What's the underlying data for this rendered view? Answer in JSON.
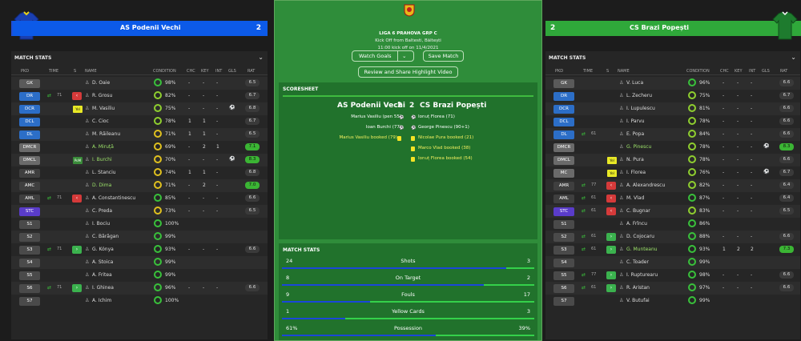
{
  "left": {
    "team": "AS Podenii Vechi",
    "score": "2",
    "section_title": "MATCH STATS",
    "headers": {
      "pkd": "PKD",
      "time": "TIME",
      "s": "S",
      "name": "NAME",
      "cond": "CONDITION",
      "chc": "CHC",
      "key": "KEY",
      "int": "INT",
      "gls": "GLS",
      "rat": "RAT"
    },
    "players": [
      {
        "pos": "GK",
        "name": "D. Oaie",
        "cond": "98%",
        "chc": "-",
        "key": "-",
        "int": "-",
        "rat": "6.5"
      },
      {
        "pos": "DR",
        "name": "R. Grosu",
        "cond": "82%",
        "chc": "-",
        "key": "-",
        "int": "-",
        "rat": "6.7",
        "time": "71",
        "btn": "red"
      },
      {
        "pos": "DCR",
        "name": "M. Vasiliu",
        "cond": "75%",
        "chc": "-",
        "key": "-",
        "int": "-",
        "rat": "6.8",
        "tag": "Yel",
        "ball": true
      },
      {
        "pos": "DCL",
        "name": "C. Cioc",
        "cond": "78%",
        "chc": "1",
        "key": "1",
        "int": "-",
        "rat": "6.7"
      },
      {
        "pos": "DL",
        "name": "M. Răileanu",
        "cond": "71%",
        "chc": "1",
        "key": "1",
        "int": "-",
        "rat": "6.5"
      },
      {
        "pos": "DMCR",
        "name": "A. Miruță",
        "cond": "69%",
        "chc": "-",
        "key": "2",
        "int": "1",
        "rat": "7.1",
        "good": true
      },
      {
        "pos": "DMCL",
        "name": "I. Burchi",
        "cond": "70%",
        "chc": "-",
        "key": "-",
        "int": "-",
        "rat": "8.3",
        "good": true,
        "tag": "PoM",
        "ball": true
      },
      {
        "pos": "AMR",
        "name": "L. Stanciu",
        "cond": "74%",
        "chc": "1",
        "key": "1",
        "int": "-",
        "rat": "6.8"
      },
      {
        "pos": "AMC",
        "name": "D. Dima",
        "cond": "71%",
        "chc": "-",
        "key": "2",
        "int": "-",
        "rat": "7.0",
        "good": true
      },
      {
        "pos": "AML",
        "name": "A. Constantinescu",
        "cond": "85%",
        "chc": "-",
        "key": "-",
        "int": "-",
        "rat": "6.6",
        "time": "71",
        "btn": "red"
      },
      {
        "pos": "STC",
        "name": "C. Preda",
        "cond": "73%",
        "chc": "-",
        "key": "-",
        "int": "-",
        "rat": "6.5"
      },
      {
        "pos": "S1",
        "name": "I. Bociu",
        "cond": "100%",
        "chc": "",
        "key": "",
        "int": "",
        "rat": ""
      },
      {
        "pos": "S2",
        "name": "C. Bărăgan",
        "cond": "99%",
        "chc": "",
        "key": "",
        "int": "",
        "rat": ""
      },
      {
        "pos": "S3",
        "name": "G. Kónya",
        "cond": "93%",
        "chc": "-",
        "key": "-",
        "int": "-",
        "rat": "6.6",
        "time": "71",
        "btn": "green"
      },
      {
        "pos": "S4",
        "name": "A. Stoica",
        "cond": "99%",
        "chc": "",
        "key": "",
        "int": "",
        "rat": ""
      },
      {
        "pos": "S5",
        "name": "A. Fritea",
        "cond": "99%",
        "chc": "",
        "key": "",
        "int": "",
        "rat": ""
      },
      {
        "pos": "S6",
        "name": "I. Ghinea",
        "cond": "96%",
        "chc": "-",
        "key": "-",
        "int": "-",
        "rat": "6.6",
        "time": "71",
        "btn": "green"
      },
      {
        "pos": "S7",
        "name": "A. Ichim",
        "cond": "100%",
        "chc": "",
        "key": "",
        "int": "",
        "rat": ""
      }
    ]
  },
  "right": {
    "team": "CS Brazi Popești",
    "score": "2",
    "section_title": "MATCH STATS",
    "headers": {
      "pkd": "PKD",
      "time": "TIME",
      "s": "S",
      "name": "NAME",
      "cond": "CONDITION",
      "chc": "CHC",
      "key": "KEY",
      "int": "INT",
      "gls": "GLS",
      "rat": "RAT"
    },
    "players": [
      {
        "pos": "GK",
        "name": "V. Luca",
        "cond": "96%",
        "chc": "-",
        "key": "-",
        "int": "-",
        "rat": "6.6"
      },
      {
        "pos": "DR",
        "name": "L. Zecheru",
        "cond": "75%",
        "chc": "-",
        "key": "-",
        "int": "-",
        "rat": "6.7"
      },
      {
        "pos": "DCR",
        "name": "I. Lupulescu",
        "cond": "81%",
        "chc": "-",
        "key": "-",
        "int": "-",
        "rat": "6.6"
      },
      {
        "pos": "DCL",
        "name": "I. Parvu",
        "cond": "78%",
        "chc": "-",
        "key": "-",
        "int": "-",
        "rat": "6.6"
      },
      {
        "pos": "DL",
        "name": "E. Popa",
        "cond": "84%",
        "chc": "-",
        "key": "-",
        "int": "-",
        "rat": "6.6",
        "time": "61"
      },
      {
        "pos": "DMCR",
        "name": "G. Pinescu",
        "cond": "78%",
        "chc": "-",
        "key": "-",
        "int": "-",
        "rat": "8.3",
        "good": true,
        "ball": true
      },
      {
        "pos": "DMCL",
        "name": "N. Pura",
        "cond": "78%",
        "chc": "-",
        "key": "-",
        "int": "-",
        "rat": "6.6",
        "tag": "Yel"
      },
      {
        "pos": "MC",
        "name": "I. Florea",
        "cond": "76%",
        "chc": "-",
        "key": "-",
        "int": "-",
        "rat": "6.7",
        "tag": "Yel",
        "ball": true
      },
      {
        "pos": "AMR",
        "name": "A. Alexandrescu",
        "cond": "82%",
        "chc": "-",
        "key": "-",
        "int": "-",
        "rat": "6.4",
        "time": "77",
        "btn": "red"
      },
      {
        "pos": "AML",
        "name": "M. Vlad",
        "cond": "87%",
        "chc": "-",
        "key": "-",
        "int": "-",
        "rat": "6.4",
        "time": "61",
        "btn": "red"
      },
      {
        "pos": "STC",
        "name": "C. Bugnar",
        "cond": "83%",
        "chc": "-",
        "key": "-",
        "int": "-",
        "rat": "6.5",
        "time": "61",
        "btn": "red"
      },
      {
        "pos": "S1",
        "name": "A. Frîncu",
        "cond": "86%",
        "chc": "",
        "key": "",
        "int": "",
        "rat": ""
      },
      {
        "pos": "S2",
        "name": "D. Cojocaru",
        "cond": "88%",
        "chc": "-",
        "key": "-",
        "int": "-",
        "rat": "6.6",
        "time": "61",
        "btn": "green"
      },
      {
        "pos": "S3",
        "name": "G. Munteanu",
        "cond": "93%",
        "chc": "1",
        "key": "2",
        "int": "2",
        "rat": "7.3",
        "good": true,
        "time": "61",
        "btn": "green"
      },
      {
        "pos": "S4",
        "name": "C. Toader",
        "cond": "99%",
        "chc": "",
        "key": "",
        "int": "",
        "rat": ""
      },
      {
        "pos": "S5",
        "name": "I. Rupturearu",
        "cond": "98%",
        "chc": "-",
        "key": "-",
        "int": "-",
        "rat": "6.6",
        "time": "77",
        "btn": "green"
      },
      {
        "pos": "S6",
        "name": "R. Aristan",
        "cond": "97%",
        "chc": "-",
        "key": "-",
        "int": "-",
        "rat": "6.6",
        "time": "61",
        "btn": "green"
      },
      {
        "pos": "S7",
        "name": "V. Butufai",
        "cond": "99%",
        "chc": "",
        "key": "",
        "int": "",
        "rat": ""
      }
    ]
  },
  "center": {
    "league": "LIGA 6 PRAHOVA GRP C",
    "kickoff": "Kick Off from Baltesti, Băltești",
    "kickoff_time": "11:00 kick off on 11/4/2021",
    "watch_goals": "Watch Goals",
    "save_match": "Save Match",
    "review": "Review and Share Highlight Video",
    "scoresheet_title": "SCORESHEET",
    "home_team": "AS Podenii Vechi",
    "home_score": "2",
    "away_score": "2",
    "away_team": "CS Brazi Popești",
    "home_events": [
      "Marius Vasiliu (pen 55)",
      "Ioan Burchi (77)",
      "Marius Vasiliu booked (79)"
    ],
    "away_events": [
      "Ionuț Florea (71)",
      "George Pinescu (90+1)",
      "Nicolae Pura booked (21)",
      "Marco Vlad booked (38)",
      "Ionuț Florea booked (54)"
    ],
    "stats_title": "MATCH STATS",
    "stats": [
      {
        "label": "Shots",
        "home": "24",
        "away": "3",
        "home_frac": 0.89
      },
      {
        "label": "On Target",
        "home": "8",
        "away": "2",
        "home_frac": 0.8
      },
      {
        "label": "Fouls",
        "home": "9",
        "away": "17",
        "home_frac": 0.35
      },
      {
        "label": "Yellow Cards",
        "home": "1",
        "away": "3",
        "home_frac": 0.25
      },
      {
        "label": "Possession",
        "home": "61%",
        "away": "39%",
        "home_frac": 0.61
      }
    ]
  },
  "colors": {
    "gk": "#5a5a5a",
    "def": "#2c6ec7",
    "dm": "#6a6a6a",
    "mid": "#4a4a4a",
    "att": "#3f3f3f",
    "st": "#5a3cc9",
    "sub": "#4a4a4a"
  }
}
